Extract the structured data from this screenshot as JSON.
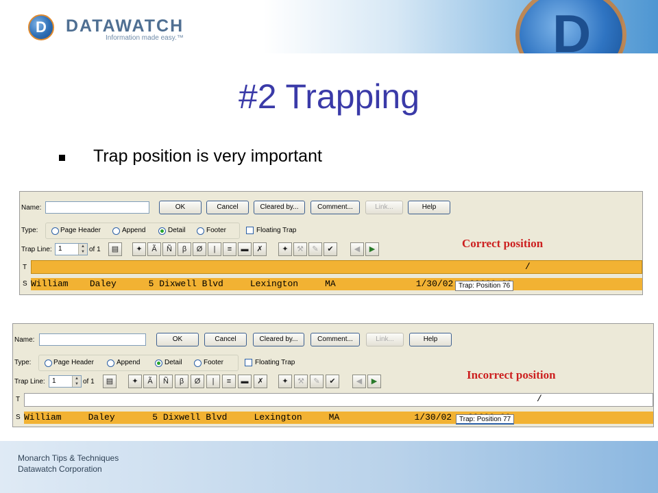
{
  "header": {
    "brand": "DATAWATCH",
    "tagline": "Information made easy.™",
    "logo_letter": "D"
  },
  "slide": {
    "title": "#2 Trapping",
    "bullet": "Trap position is very important"
  },
  "trap_panels": [
    {
      "name_label": "Name:",
      "buttons": {
        "ok": "OK",
        "cancel": "Cancel",
        "cleared_by": "Cleared by...",
        "comment": "Comment...",
        "link": "Link...",
        "help": "Help"
      },
      "type_label": "Type:",
      "type_options": [
        "Page Header",
        "Append",
        "Detail",
        "Footer"
      ],
      "selected_type": "Detail",
      "floating_trap": "Floating Trap",
      "trap_line_label": "Trap Line:",
      "trap_line_value": "1",
      "trap_line_of": "of 1",
      "ruler_label": "T",
      "ruler_mark": "/",
      "sample_label": "S",
      "sample_line": "William    Daley      5 Dixwell Blvd     Lexington     MA               1/30/02   39600.00",
      "tooltip": "Trap: Position 76",
      "position_label": "Correct position"
    },
    {
      "name_label": "Name:",
      "buttons": {
        "ok": "OK",
        "cancel": "Cancel",
        "cleared_by": "Cleared by...",
        "comment": "Comment...",
        "link": "Link...",
        "help": "Help"
      },
      "type_label": "Type:",
      "type_options": [
        "Page Header",
        "Append",
        "Detail",
        "Footer"
      ],
      "selected_type": "Detail",
      "floating_trap": "Floating Trap",
      "trap_line_label": "Trap Line:",
      "trap_line_value": "1",
      "trap_line_of": "of 1",
      "ruler_label": "T",
      "ruler_mark": "/",
      "sample_label": "S",
      "sample_line": "William     Daley       5 Dixwell Blvd     Lexington     MA              1/30/02   39600.00",
      "tooltip": "Trap: Position 77",
      "position_label": "Incorrect position"
    }
  ],
  "toolbar_icons": [
    "trap-wand-icon",
    "any-char-icon",
    "alpha-icon",
    "beta-icon",
    "null-icon",
    "pipe-icon",
    "numeric-icon",
    "blank-icon",
    "clear-trap-icon",
    "wand-edit-icon",
    "wrench-icon",
    "pencil-icon",
    "check-edit-icon",
    "prev-icon",
    "next-icon"
  ],
  "colors": {
    "title": "#3a3aa8",
    "sample_row": "#f2b233",
    "position_label": "#cc1f1f"
  },
  "footer": {
    "line1": "Monarch Tips & Techniques",
    "line2": "Datawatch Corporation"
  }
}
